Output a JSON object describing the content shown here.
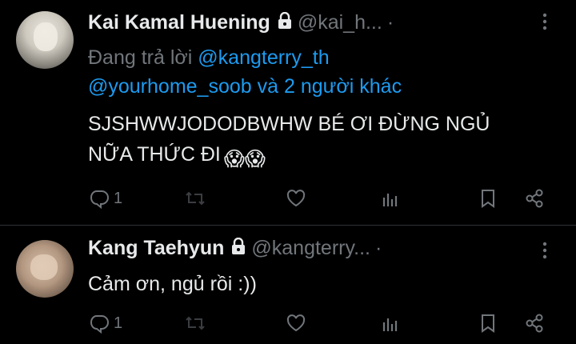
{
  "tweets": [
    {
      "author_name": "Kai Kamal Huening",
      "handle": "@kai_h...",
      "separator": "·",
      "replying_prefix": "Đang trả lời",
      "replying_user1": "@kangterry_th",
      "replying_user2": "@yourhome_soob",
      "replying_suffix": "và 2 người khác",
      "text_line1": "SJSHWWJODODBWHW BÉ ƠI ĐỪNG NGỦ",
      "text_line2": "NỮA THỨC ĐI",
      "emoji": "😱😱",
      "reply_count": "1",
      "icons": [
        "lock-icon",
        "more-icon",
        "reply-icon",
        "retweet-icon",
        "like-icon",
        "views-icon",
        "bookmark-icon",
        "share-icon"
      ]
    },
    {
      "author_name": "Kang Taehyun",
      "handle": "@kangterry...",
      "separator": "·",
      "text": "Cảm ơn, ngủ rồi :))",
      "reply_count": "1"
    }
  ],
  "colors": {
    "background": "#000000",
    "text": "#e7e9ea",
    "muted": "#71767b",
    "link": "#1d9bf0",
    "divider": "#2f3336"
  }
}
